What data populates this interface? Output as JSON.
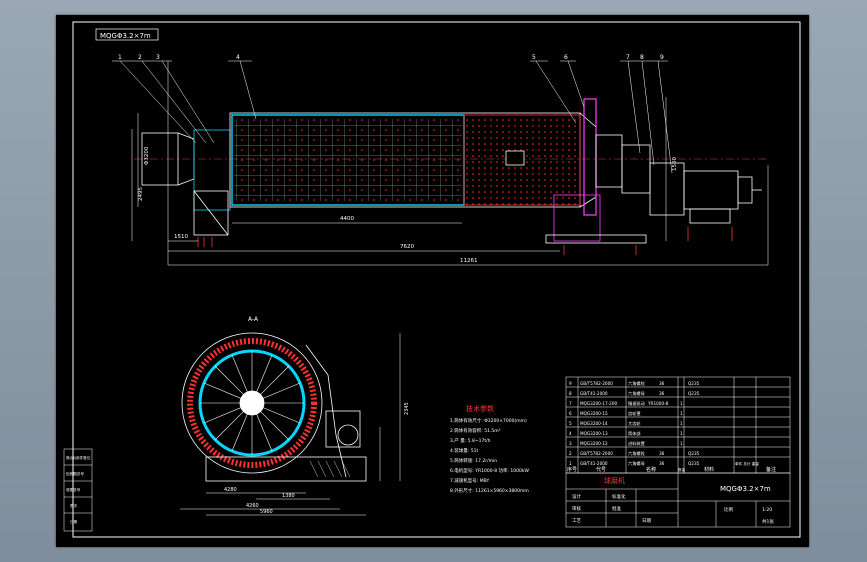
{
  "colors": {
    "background": "#8c9aa8",
    "sheet": "#000000",
    "line": "#ffffff",
    "dimension": "#ffffff",
    "shell_hatch": "#ff3030",
    "liner": "#00d8ff",
    "highlight": "#ff40ff",
    "yellow": "#ffd700"
  },
  "title_tag": "MQGΦ3.2×7m",
  "balloons": [
    "1",
    "2",
    "3",
    "4",
    "5",
    "6",
    "7",
    "8",
    "9"
  ],
  "dims": {
    "overall_length": "11261",
    "shell_length": "7620",
    "inner_length": "4400",
    "left_offset": "1510",
    "diameter": "Φ3200",
    "height_left": "2495",
    "height_right": "1500",
    "side_height": "2345",
    "side_width1": "4280",
    "side_width2": "1380",
    "side_width3": "4260",
    "side_bottom": "5960"
  },
  "section_label": "A-A",
  "tech": {
    "heading": "技术参数",
    "lines": [
      "1.筒体有效尺寸: Φ3200×7000(mm)",
      "2.筒体有效容积: 51.5m³",
      "3.产  量: 5.8~17t/h",
      "4.装球量: 51t",
      "5.筒体转速: 17.2r/min",
      "6.电机型号: YR1000-8  功率: 1000kW",
      "7.减速机型号: MBY",
      "8.外形尺寸: 11261×5960×3800mm"
    ]
  },
  "bom": {
    "rows": [
      [
        "9",
        "GB/T5782-2000",
        "六角螺栓",
        "36",
        "",
        "Q235"
      ],
      [
        "8",
        "GB/T41-2000",
        "六角螺母",
        "36",
        "",
        "Q235"
      ],
      [
        "7",
        "MQG3200-17-200",
        "慢速驱动",
        "YR1000-8",
        "1",
        ""
      ],
      [
        "6",
        "MQG3200-15",
        "齿轮罩",
        "",
        "1",
        ""
      ],
      [
        "5",
        "MQG3200-14",
        "大齿轮",
        "",
        "1",
        ""
      ],
      [
        "4",
        "MQG3200-13",
        "筒体部",
        "",
        "1",
        ""
      ],
      [
        "3",
        "MQG3200-12",
        "进料装置",
        "",
        "1",
        ""
      ],
      [
        "2",
        "GB/T5782-2000",
        "六角螺栓",
        "36",
        "",
        "Q235"
      ],
      [
        "1",
        "GB/T41-2000",
        "六角螺母",
        "36",
        "",
        "Q235"
      ]
    ],
    "header": [
      "序号",
      "代号",
      "名称",
      "数量",
      "材料",
      "单件 总计 重量",
      "备注"
    ]
  },
  "title_block": {
    "drawing_name": "球磨机",
    "model": "MQGΦ3.2×7m",
    "scale_label": "比例",
    "scale": "1:20",
    "sheet": "共1张",
    "design": "设计",
    "check": "审核",
    "process": "工艺",
    "approve": "批准",
    "std": "标准化",
    "date": "日期"
  },
  "left_stamp": [
    "借(通)用件登记",
    "旧底图总号",
    "底图总号",
    "签字",
    "日期"
  ]
}
